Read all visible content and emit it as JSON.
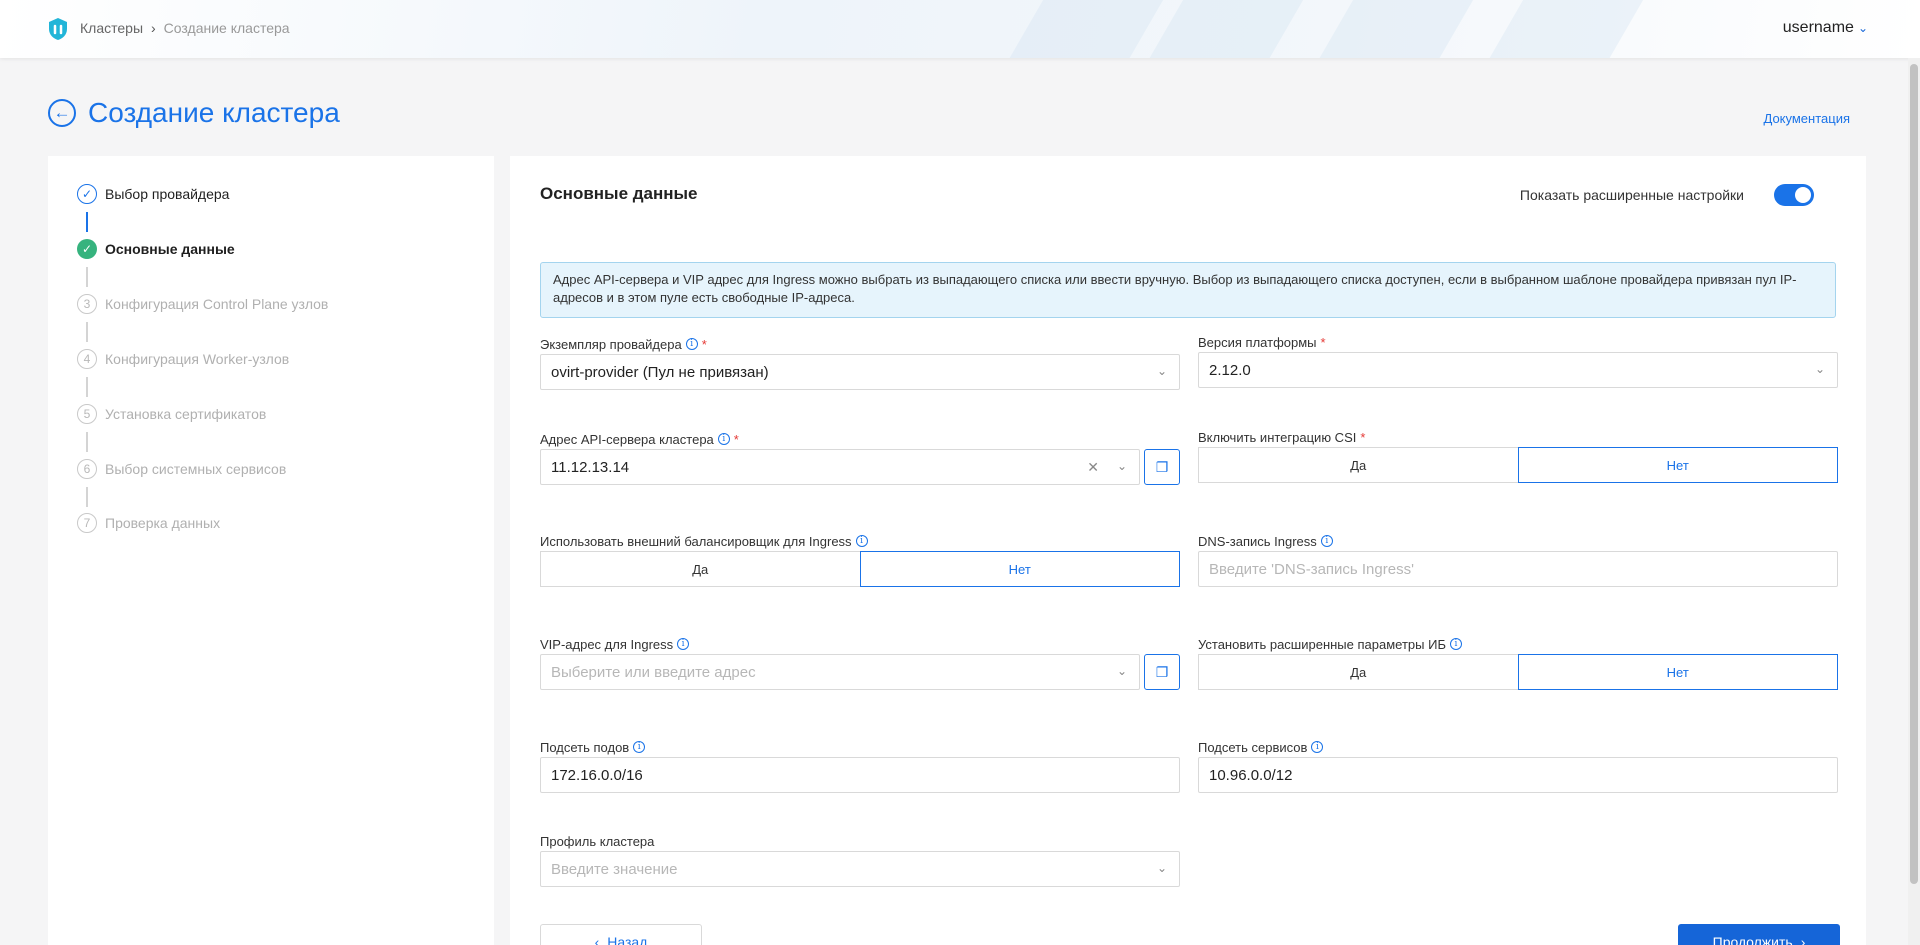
{
  "header": {
    "breadcrumbs": [
      "Кластеры",
      "Создание кластера"
    ],
    "user": "username",
    "logo_icon": "shield-logo-icon",
    "accent": "#1a73e8"
  },
  "page": {
    "title": "Создание кластера",
    "doc_link": "Документация"
  },
  "steps": [
    {
      "num": "1",
      "label": "Выбор провайдера",
      "state": "done"
    },
    {
      "num": "2",
      "label": "Основные данные",
      "state": "active"
    },
    {
      "num": "3",
      "label": "Конфигурация Control Plane узлов",
      "state": "todo"
    },
    {
      "num": "4",
      "label": "Конфигурация Worker-узлов",
      "state": "todo"
    },
    {
      "num": "5",
      "label": "Установка сертификатов",
      "state": "todo"
    },
    {
      "num": "6",
      "label": "Выбор системных сервисов",
      "state": "todo"
    },
    {
      "num": "7",
      "label": "Проверка данных",
      "state": "todo"
    }
  ],
  "form": {
    "section_title": "Основные данные",
    "advanced_label": "Показать расширенные настройки",
    "advanced_enabled": true,
    "info": "Адрес API-сервера и VIP адрес для Ingress можно выбрать из выпадающего списка или ввести вручную. Выбор из выпадающего списка доступен, если в выбранном шаблоне провайдера привязан пул IP-адресов и в этом пуле есть свободные IP-адреса.",
    "provider": {
      "label": "Экземпляр провайдера",
      "value": "ovirt-provider (Пул не привязан)"
    },
    "platform": {
      "label": "Версия платформы",
      "value": "2.12.0"
    },
    "api_server": {
      "label": "Адрес API-сервера кластера",
      "value": "11.12.13.14"
    },
    "csi": {
      "label": "Включить интеграцию CSI",
      "yes": "Да",
      "no": "Нет",
      "selected": "Нет"
    },
    "ext_lb": {
      "label": "Использовать внешний балансировщик для Ingress",
      "yes": "Да",
      "no": "Нет",
      "selected": "Нет"
    },
    "dns": {
      "label": "DNS-запись Ingress",
      "placeholder": "Введите 'DNS-запись Ingress'"
    },
    "vip": {
      "label": "VIP-адрес для Ingress",
      "placeholder": "Выберите или введите адрес"
    },
    "security": {
      "label": "Установить расширенные параметры ИБ",
      "yes": "Да",
      "no": "Нет",
      "selected": "Нет"
    },
    "pod_subnet": {
      "label": "Подсеть подов",
      "value": "172.16.0.0/16"
    },
    "svc_subnet": {
      "label": "Подсеть сервисов",
      "value": "10.96.0.0/12"
    },
    "profile": {
      "label": "Профиль кластера",
      "placeholder": "Введите значение"
    },
    "back_label": "Назад",
    "next_label": "Продолжить"
  }
}
